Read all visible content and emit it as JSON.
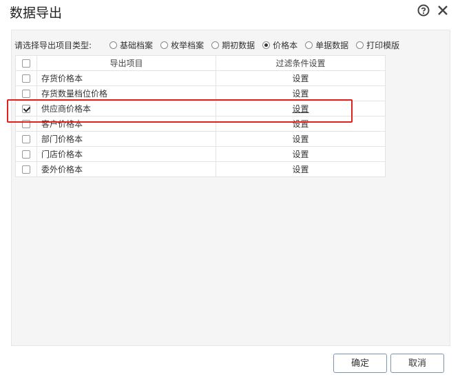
{
  "dialog": {
    "title": "数据导出",
    "help_icon": "help-circle-icon",
    "close_icon": "close-icon"
  },
  "type_selector": {
    "label": "请选择导出项目类型:",
    "options": [
      {
        "label": "基础档案",
        "selected": false
      },
      {
        "label": "枚举档案",
        "selected": false
      },
      {
        "label": "期初数据",
        "selected": false
      },
      {
        "label": "价格本",
        "selected": true
      },
      {
        "label": "单据数据",
        "selected": false
      },
      {
        "label": "打印模版",
        "selected": false
      }
    ]
  },
  "table": {
    "headers": {
      "item": "导出项目",
      "filter": "过滤条件设置"
    },
    "rows": [
      {
        "name": "存货价格本",
        "setting": "设置",
        "checked": false
      },
      {
        "name": "存货数量档位价格",
        "setting": "设置",
        "checked": false
      },
      {
        "name": "供应商价格本",
        "setting": "设置",
        "checked": true
      },
      {
        "name": "客户价格本",
        "setting": "设置",
        "checked": false
      },
      {
        "name": "部门价格本",
        "setting": "设置",
        "checked": false
      },
      {
        "name": "门店价格本",
        "setting": "设置",
        "checked": false
      },
      {
        "name": "委外价格本",
        "setting": "设置",
        "checked": false
      }
    ]
  },
  "buttons": {
    "ok": "确定",
    "cancel": "取消"
  },
  "colors": {
    "highlight": "#e02020",
    "button_border": "#7a96b4",
    "panel_bg": "#f5f5f5"
  }
}
